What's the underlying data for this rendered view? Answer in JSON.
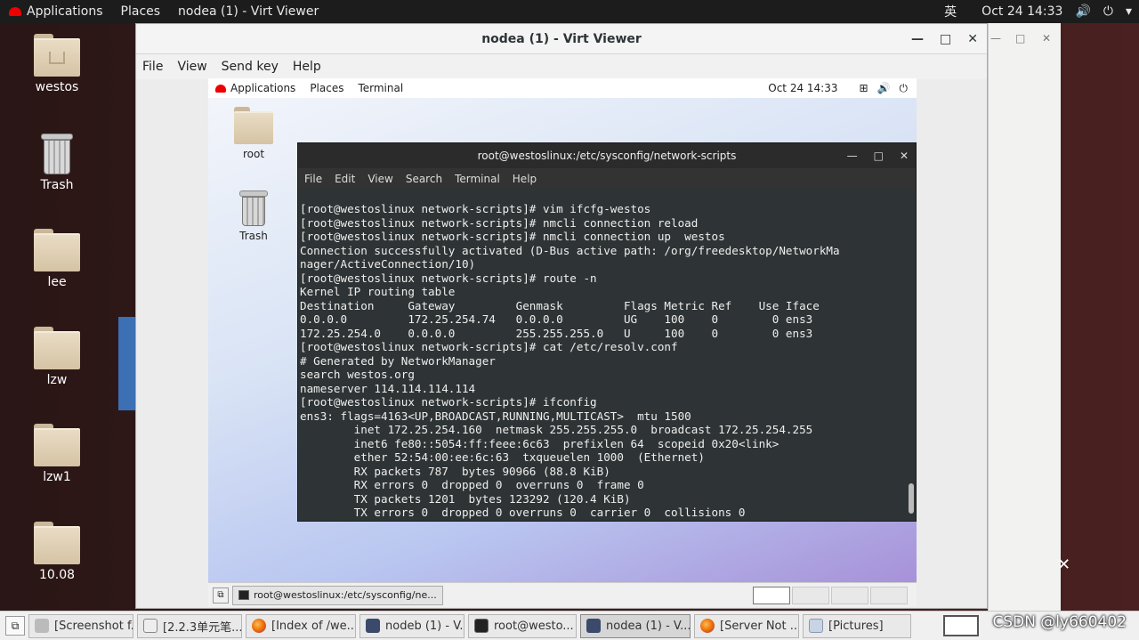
{
  "host_topbar": {
    "applications": "Applications",
    "places": "Places",
    "window": "nodea (1) - Virt Viewer",
    "input_method": "英",
    "datetime": "Oct 24  14:33"
  },
  "host_desktop_icons": [
    "westos",
    "Trash",
    "lee",
    "lzw",
    "lzw1",
    "10.08"
  ],
  "virt_viewer": {
    "title": "nodea (1) - Virt Viewer",
    "menu": [
      "File",
      "View",
      "Send key",
      "Help"
    ]
  },
  "guest": {
    "topbar": {
      "applications": "Applications",
      "places": "Places",
      "terminal": "Terminal",
      "datetime": "Oct 24  14:33"
    },
    "desktop_icons": [
      "root",
      "Trash"
    ],
    "terminal": {
      "title": "root@westoslinux:/etc/sysconfig/network-scripts",
      "menu": [
        "File",
        "Edit",
        "View",
        "Search",
        "Terminal",
        "Help"
      ],
      "lines": [
        "[root@westoslinux network-scripts]# vim ifcfg-westos",
        "[root@westoslinux network-scripts]# nmcli connection reload",
        "[root@westoslinux network-scripts]# nmcli connection up  westos",
        "Connection successfully activated (D-Bus active path: /org/freedesktop/NetworkMa",
        "nager/ActiveConnection/10)",
        "[root@westoslinux network-scripts]# route -n",
        "Kernel IP routing table",
        "Destination     Gateway         Genmask         Flags Metric Ref    Use Iface",
        "0.0.0.0         172.25.254.74   0.0.0.0         UG    100    0        0 ens3",
        "172.25.254.0    0.0.0.0         255.255.255.0   U     100    0        0 ens3",
        "[root@westoslinux network-scripts]# cat /etc/resolv.conf",
        "# Generated by NetworkManager",
        "search westos.org",
        "nameserver 114.114.114.114",
        "[root@westoslinux network-scripts]# ifconfig",
        "ens3: flags=4163<UP,BROADCAST,RUNNING,MULTICAST>  mtu 1500",
        "        inet 172.25.254.160  netmask 255.255.255.0  broadcast 172.25.254.255",
        "        inet6 fe80::5054:ff:feee:6c63  prefixlen 64  scopeid 0x20<link>",
        "        ether 52:54:00:ee:6c:63  txqueuelen 1000  (Ethernet)",
        "        RX packets 787  bytes 90966 (88.8 KiB)",
        "        RX errors 0  dropped 0  overruns 0  frame 0",
        "        TX packets 1201  bytes 123292 (120.4 KiB)",
        "        TX errors 0  dropped 0 overruns 0  carrier 0  collisions 0"
      ]
    },
    "taskbar_item": "root@westoslinux:/etc/sysconfig/ne..."
  },
  "host_taskbar": {
    "items": [
      "[Screenshot f...",
      "[2.2.3单元笔...",
      "[Index of /we...",
      "nodeb (1) - V...",
      "root@westo...",
      "nodea (1) - V...",
      "[Server Not ...",
      "[Pictures]"
    ]
  },
  "watermark": "CSDN @ly660402",
  "colors": {
    "terminal_bg": "#2e3436",
    "terminal_fg": "#eeeeec",
    "host_topbar": "#1c1c1c"
  }
}
